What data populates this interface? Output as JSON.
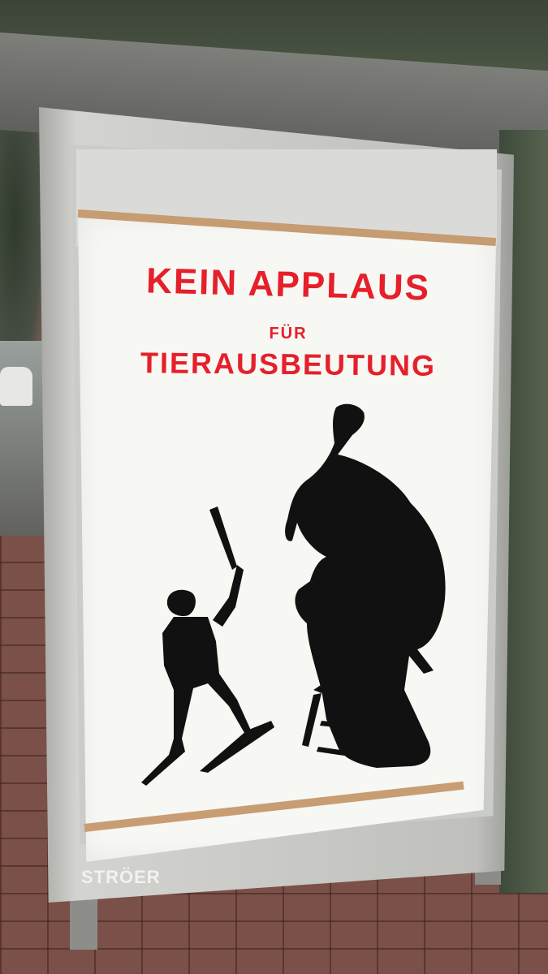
{
  "poster": {
    "headline_line1": "KEIN APPLAUS",
    "headline_line2": "FÜR",
    "headline_line3": "TIERAUSBEUTUNG",
    "headline_color": "#e5202a",
    "figures": [
      "person-with-whip-silhouette",
      "elephant-on-stool-silhouette"
    ]
  },
  "frame": {
    "brand_label": "STRÖER"
  }
}
